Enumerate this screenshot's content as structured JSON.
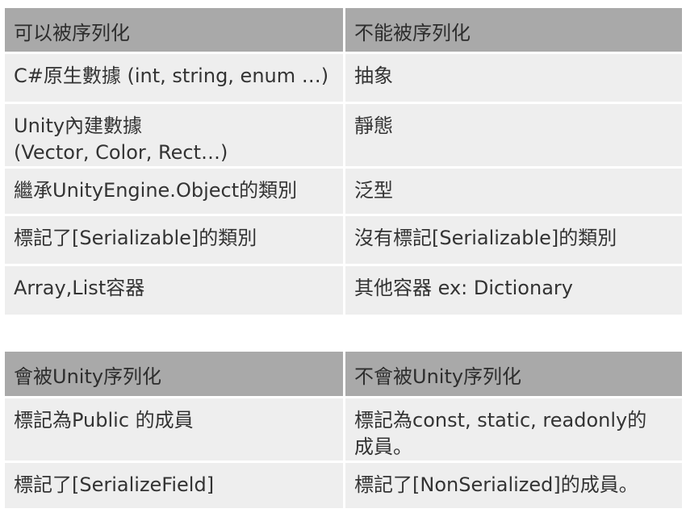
{
  "table1": {
    "headers": [
      "可以被序列化",
      "不能被序列化"
    ],
    "rows": [
      [
        "C#原生數據 (int, string, enum …)",
        "抽象"
      ],
      [
        "Unity內建數據\n(Vector, Color, Rect…)",
        "靜態"
      ],
      [
        "繼承UnityEngine.Object的類別",
        "泛型"
      ],
      [
        "標記了[Serializable]的類別",
        "沒有標記[Serializable]的類別"
      ],
      [
        "Array,List容器",
        "其他容器 ex: Dictionary"
      ]
    ]
  },
  "table2": {
    "headers": [
      "會被Unity序列化",
      "不會被Unity序列化"
    ],
    "rows": [
      [
        "標記為Public 的成員",
        "標記為const, static, readonly的\n成員。"
      ],
      [
        "標記了[SerializeField]",
        "標記了[NonSerialized]的成員。"
      ]
    ]
  },
  "colors": {
    "header_bg": "#a9a9a9",
    "row_bg": "#eeeeee",
    "text": "#333333"
  }
}
